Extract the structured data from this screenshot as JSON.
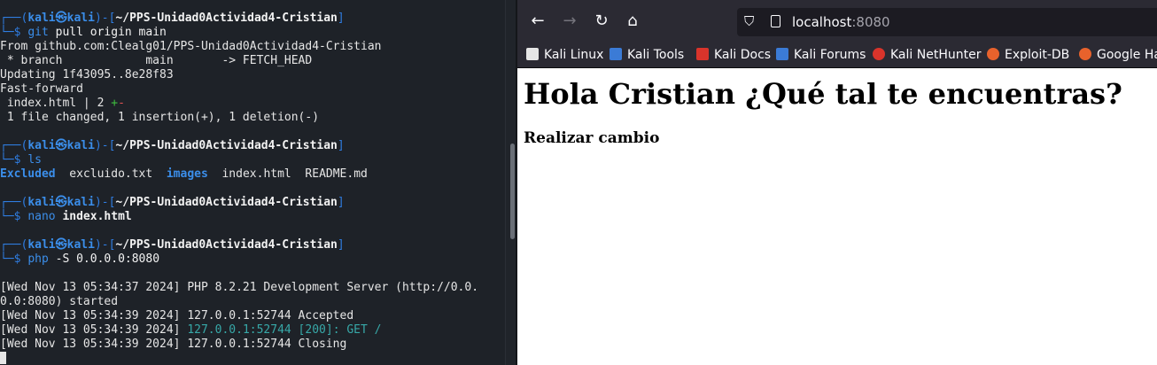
{
  "terminal": {
    "prompt": {
      "frame_open": "┌──(",
      "user": "kali㉿kali",
      "frame_mid": ")-[",
      "path": "~/PPS-Unidad0Actividad4-Cristian",
      "frame_close": "]",
      "corner": "└─",
      "dollar": "$ "
    },
    "blocks": [
      {
        "command": "git",
        "args": " pull origin main",
        "output": [
          "From github.com:Clealg01/PPS-Unidad0Actividad4-Cristian",
          " * branch            main       -> FETCH_HEAD",
          "Updating 1f43095..8e28f83",
          "Fast-forward"
        ],
        "diffstat": {
          "file": " index.html | 2 ",
          "plus": "+",
          "minus": "-"
        },
        "summary": " 1 file changed, 1 insertion(+), 1 deletion(-)"
      },
      {
        "command": "ls",
        "listing": {
          "dir1": "Excluded",
          "file1": "excluido.txt",
          "dir2": "images",
          "file2": "index.html",
          "file3": "README.md"
        }
      },
      {
        "command": "nano",
        "arg_bold": "index.html"
      },
      {
        "command": "php",
        "args": " -S 0.0.0.0:8080",
        "log": [
          "[Wed Nov 13 05:34:37 2024] PHP 8.2.21 Development Server (http://0.0.",
          "0.0:8080) started",
          "[Wed Nov 13 05:34:39 2024] 127.0.0.1:52744 Accepted"
        ],
        "log_get": {
          "prefix": "[Wed Nov 13 05:34:39 2024] ",
          "colored": "127.0.0.1:52744 [200]: GET /"
        },
        "log_last": "[Wed Nov 13 05:34:39 2024] 127.0.0.1:52744 Closing"
      }
    ]
  },
  "browser": {
    "url_host": "localhost",
    "url_port": ":8080",
    "icons": {
      "back": "←",
      "forward": "→",
      "reload": "↻",
      "home": "⌂",
      "shield": "⛉"
    },
    "bookmarks": [
      {
        "label": "Kali Linux",
        "icon": "kali-dragon-icon",
        "color": "#e6e6e6"
      },
      {
        "label": "Kali Tools",
        "icon": "kali-tools-icon",
        "color": "#3b7bd6"
      },
      {
        "label": "Kali Docs",
        "icon": "kali-docs-icon",
        "color": "#d9342b"
      },
      {
        "label": "Kali Forums",
        "icon": "kali-forums-icon",
        "color": "#3b7bd6"
      },
      {
        "label": "Kali NetHunter",
        "icon": "kali-nethunter-icon",
        "color": "#d9342b"
      },
      {
        "label": "Exploit-DB",
        "icon": "exploit-db-icon",
        "color": "#e8622c"
      },
      {
        "label": "Google Ha",
        "icon": "google-hacking-icon",
        "color": "#e8622c"
      }
    ],
    "page": {
      "heading": "Hola Cristian ¿Qué tal te encuentras?",
      "subheading": "Realizar cambio"
    }
  }
}
